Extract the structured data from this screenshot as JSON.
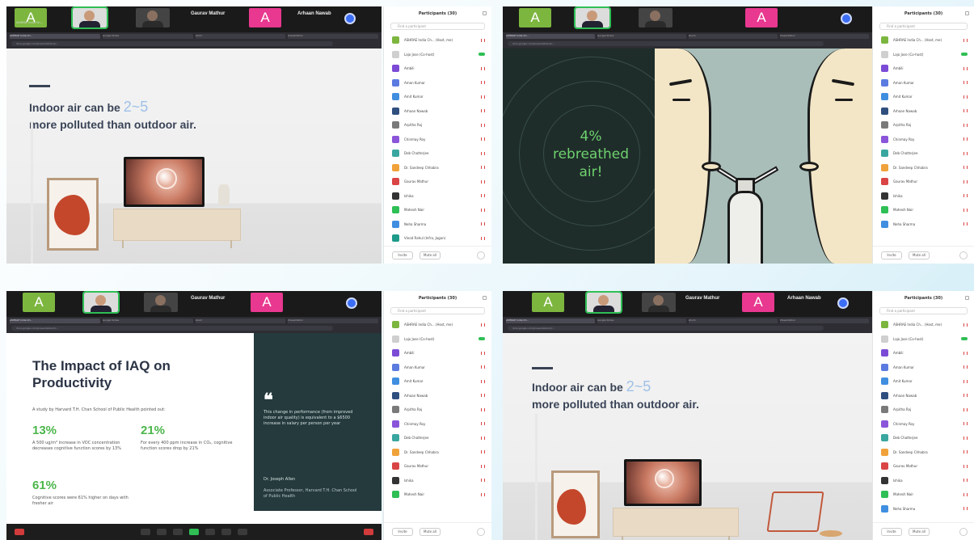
{
  "meeting": {
    "tiles": [
      {
        "initial": "A",
        "name": "ASHRAE India Ch..."
      },
      {
        "name": "Lajo Jose"
      },
      {
        "name": "Gaurav Mathur"
      },
      {
        "initial": "A",
        "name": "Arhaan Nawab"
      }
    ],
    "big_name_gaurav": "Gaurav Mathur",
    "big_name_arhaan": "Arhaan Nawab"
  },
  "browser": {
    "tabs": [
      "ASHRAE India Ch...",
      "Google Slides",
      "Zoom",
      "Presentation"
    ],
    "url": "docs.google.com/presentation/d/..."
  },
  "slide_air": {
    "title_prefix": "Indoor air can be",
    "range": "2~5",
    "title_line2": "more polluted than outdoor air."
  },
  "slide_rebreathe": {
    "line1": "4%",
    "line2": "rebreathed",
    "line3": "air!"
  },
  "slide_iaq": {
    "title": "The Impact of IAQ on Productivity",
    "subtitle": "A study by Harvard T.H. Chan School of Public Health pointed out:",
    "stats": [
      {
        "num": "13%",
        "desc": "A 500 ug/m³ increase in VOC concentration decreases cognitive function scores by 13%"
      },
      {
        "num": "21%",
        "desc": "For every 400 ppm increase in CO₂, cognitive function scores drop by 21%"
      },
      {
        "num": "61%",
        "desc": "Cognitive scores were 61% higher on days with fresher air"
      }
    ],
    "quote_mark": "❝",
    "quote": "This change in performance (from improved indoor air quality) is equivalent to a $6500 increase in salary per person per year",
    "quote_author": "Dr. Joseph Allen",
    "quote_role": "Associate Professor, Harvard T.H. Chan School of Public Health"
  },
  "roster": {
    "title": "Participants (30)",
    "search_placeholder": "Find a participant",
    "invite_label": "Invite",
    "mute_all_label": "Mute all",
    "participants": [
      {
        "name": "ASHRAE India Ch... (Host, me)",
        "color": "#7db63f",
        "mic": "off"
      },
      {
        "name": "Lajo Jose (Co-host)",
        "color": "#cfcfcf",
        "mic": "on"
      },
      {
        "name": "Ambili",
        "color": "#7c4bd6",
        "mic": "off"
      },
      {
        "name": "Aman Kumar",
        "color": "#5b7be0",
        "mic": "off"
      },
      {
        "name": "Amit Kumar",
        "color": "#3f8ee0",
        "mic": "off"
      },
      {
        "name": "Arhaan Nawab",
        "color": "#2f4f7f",
        "mic": "off"
      },
      {
        "name": "Arpitha Raj",
        "color": "#7a7a7a",
        "mic": "off"
      },
      {
        "name": "Chinmay Roy",
        "color": "#8a55d9",
        "mic": "off"
      },
      {
        "name": "Deb Chatterjee",
        "color": "#3aa6a0",
        "mic": "off"
      },
      {
        "name": "Dr. Sandeep Chhabra",
        "color": "#f0a23a",
        "mic": "off"
      },
      {
        "name": "Gaurav Mathur",
        "color": "#d94545",
        "mic": "off"
      },
      {
        "name": "Ishika",
        "color": "#333333",
        "mic": "off"
      },
      {
        "name": "Mahesh Nair",
        "color": "#2fbf55",
        "mic": "off"
      },
      {
        "name": "Neha Sharma",
        "color": "#3f8ee0",
        "mic": "off"
      },
      {
        "name": "Vinod Rahul (Infra, Jagan)",
        "color": "#1d9a8a",
        "mic": "off"
      }
    ]
  }
}
